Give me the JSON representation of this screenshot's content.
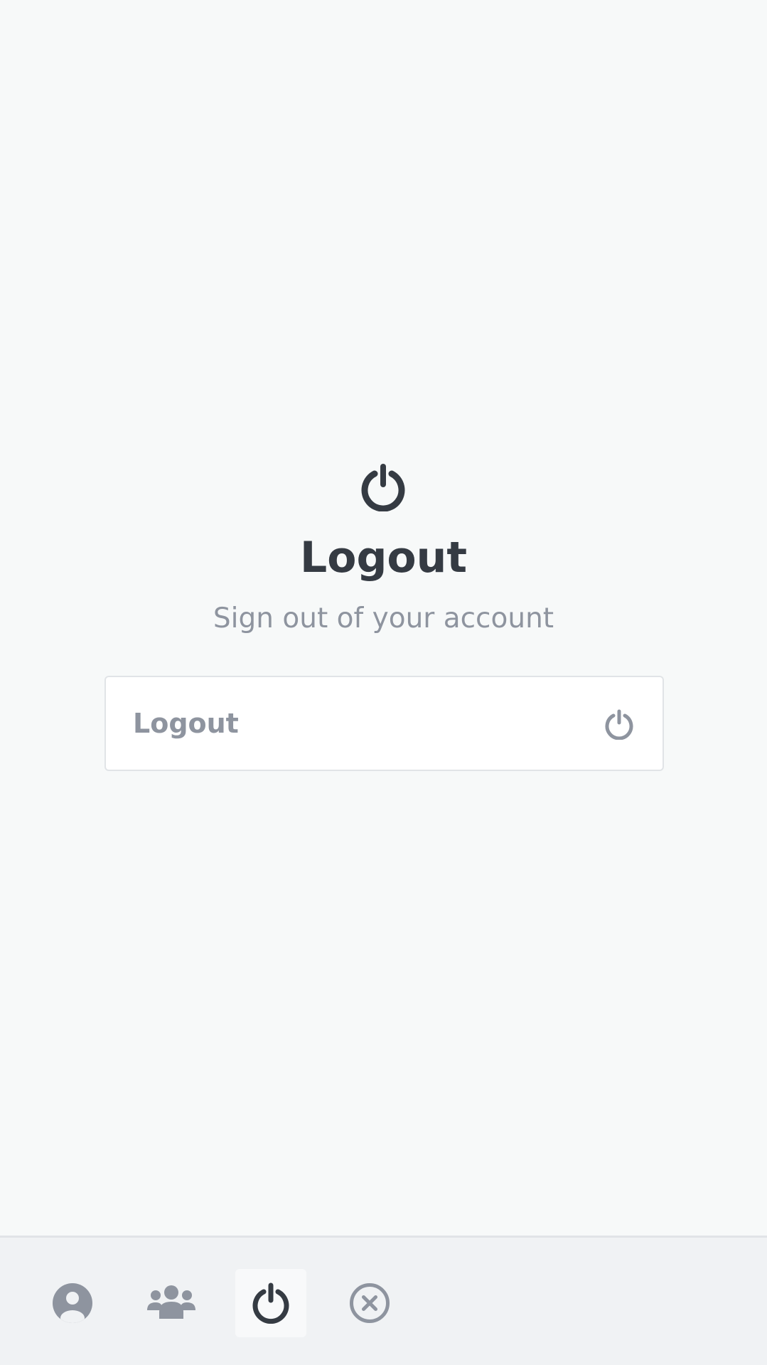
{
  "page": {
    "title": "Logout",
    "subtitle": "Sign out of your account",
    "hero_icon": "power-icon"
  },
  "logout_button": {
    "label": "Logout",
    "icon": "power-icon"
  },
  "bottom_nav": {
    "items": [
      {
        "icon": "user-circle-icon",
        "active": false
      },
      {
        "icon": "users-group-icon",
        "active": false
      },
      {
        "icon": "power-icon",
        "active": true
      },
      {
        "icon": "close-circle-icon",
        "active": false
      }
    ]
  },
  "colors": {
    "background": "#f7f9f9",
    "bottom_bar": "#f0f2f4",
    "title": "#353b43",
    "muted": "#8e949f",
    "border": "#e1e4e7",
    "card": "#ffffff"
  }
}
